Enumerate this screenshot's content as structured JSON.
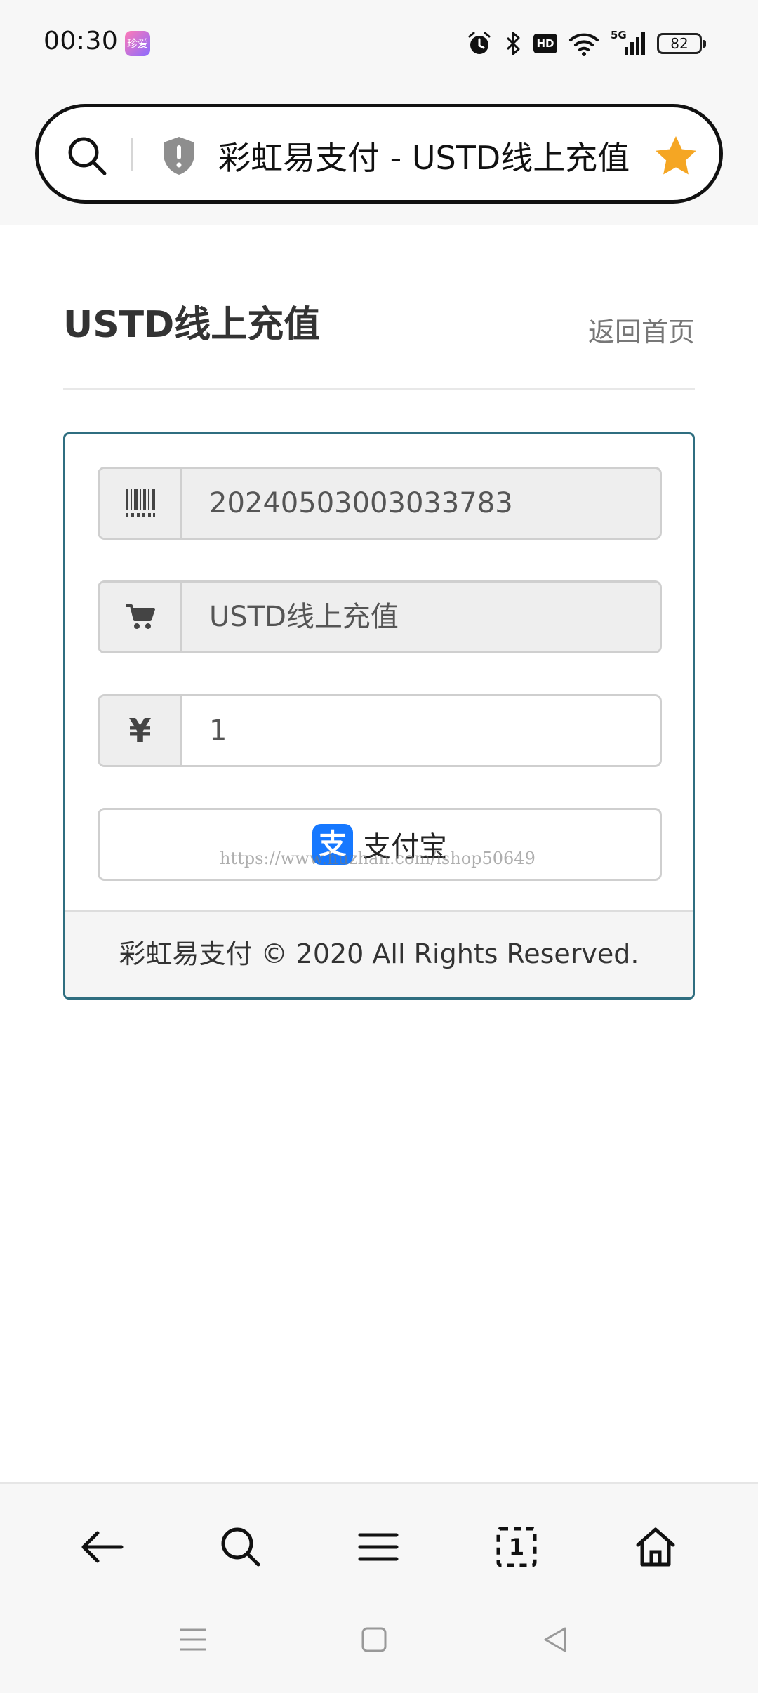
{
  "status_bar": {
    "time": "00:30",
    "app_icon_label": "珍爱",
    "hd_label": "HD",
    "network": "5G",
    "battery": "82"
  },
  "browser": {
    "tab_title": "彩虹易支付 - USTD线上充值",
    "icons": [
      "search-icon",
      "shield-icon",
      "star-icon"
    ]
  },
  "page": {
    "title": "USTD线上充值",
    "back_link": "返回首页"
  },
  "form": {
    "order_no": "20240503003033783",
    "product_name": "USTD线上充值",
    "currency_symbol": "¥",
    "amount": "1",
    "pay_button_label": "支付宝",
    "alipay_logo_char": "支",
    "watermark": "https://www.huzhan.com/ishop50649"
  },
  "footer": {
    "text": "彩虹易支付 © 2020 All Rights Reserved."
  },
  "toolbar": {
    "items": [
      "back-arrow-icon",
      "search-icon",
      "menu-icon",
      "tabs-icon",
      "home-icon"
    ],
    "tab_count": "1"
  },
  "system_nav": {
    "items": [
      "recents-icon",
      "home-square-icon",
      "back-triangle-icon"
    ]
  },
  "colors": {
    "panel_border": "#2f6e80",
    "star": "#f5a623",
    "alipay": "#1678ff"
  }
}
